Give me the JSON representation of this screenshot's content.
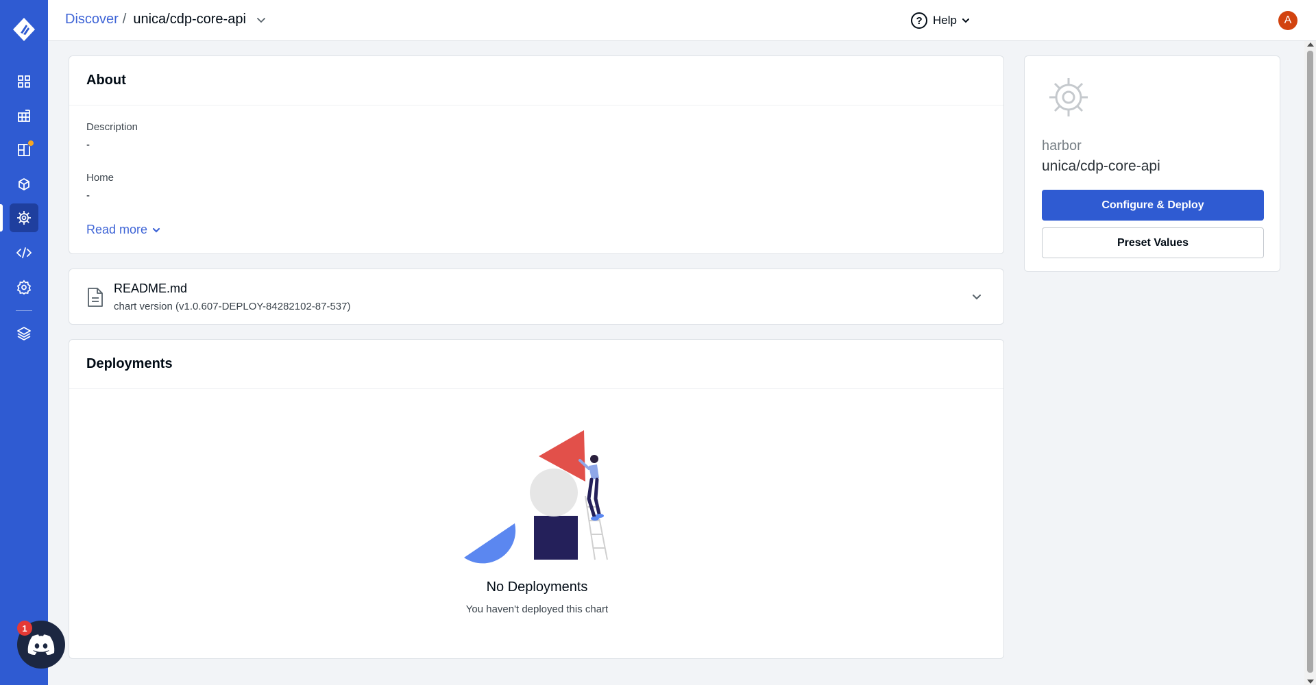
{
  "header": {
    "breadcrumb_root": "Discover",
    "breadcrumb_sep": "/",
    "breadcrumb_current": "unica/cdp-core-api",
    "help_label": "Help",
    "help_glyph": "?",
    "avatar_initial": "A"
  },
  "sidebar": {
    "items": [
      {
        "icon": "dashboard-grid-icon"
      },
      {
        "icon": "table-grid-icon"
      },
      {
        "icon": "widgets-icon",
        "has_notification_dot": true
      },
      {
        "icon": "cube-icon"
      },
      {
        "icon": "helm-wheel-icon",
        "active": true
      },
      {
        "icon": "code-icon"
      },
      {
        "icon": "settings-gear-icon"
      },
      {
        "icon": "layers-icon"
      }
    ]
  },
  "about": {
    "title": "About",
    "description_label": "Description",
    "description_value": "-",
    "home_label": "Home",
    "home_value": "-",
    "read_more": "Read more"
  },
  "readme": {
    "filename": "README.md",
    "version_text": "chart version (v1.0.607-DEPLOY-84282102-87-537)"
  },
  "deployments": {
    "title": "Deployments",
    "empty_title": "No Deployments",
    "empty_subtitle": "You haven't deployed this chart"
  },
  "chart_panel": {
    "repository": "harbor",
    "chart_name": "unica/cdp-core-api",
    "configure_button": "Configure & Deploy",
    "preset_button": "Preset Values"
  },
  "discord": {
    "badge_count": "1"
  },
  "colors": {
    "brand": "#2f5bd2",
    "link": "#3e64d6",
    "avatar": "#d2430f",
    "notification": "#f5a623"
  }
}
